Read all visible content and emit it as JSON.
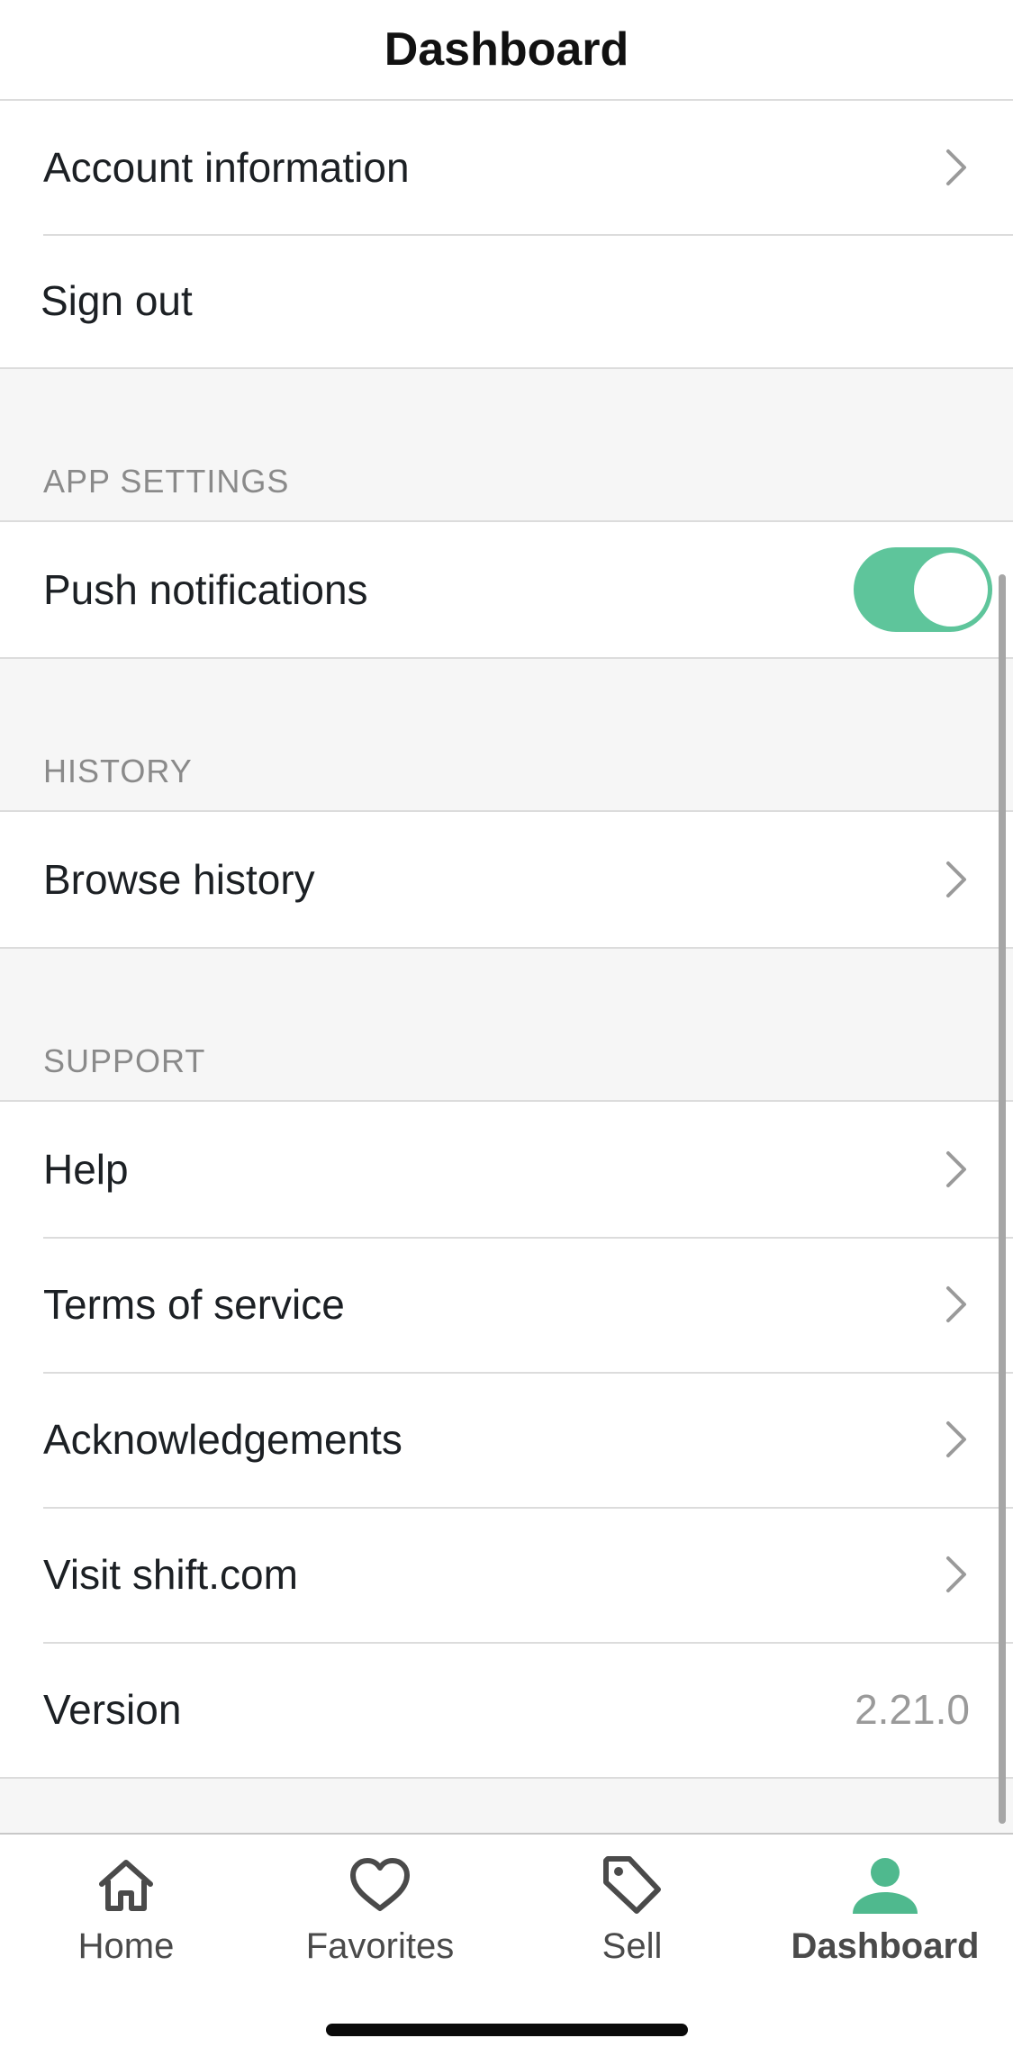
{
  "header": {
    "title": "Dashboard"
  },
  "account": {
    "items": [
      {
        "label": "Account information"
      },
      {
        "label": "Sign out"
      }
    ]
  },
  "app_settings": {
    "header": "APP SETTINGS",
    "push_notifications": {
      "label": "Push notifications",
      "enabled": true
    }
  },
  "history": {
    "header": "HISTORY",
    "items": [
      {
        "label": "Browse history"
      }
    ]
  },
  "support": {
    "header": "SUPPORT",
    "items": [
      {
        "label": "Help"
      },
      {
        "label": "Terms of service"
      },
      {
        "label": "Acknowledgements"
      },
      {
        "label": "Visit shift.com"
      }
    ],
    "version": {
      "label": "Version",
      "value": "2.21.0"
    }
  },
  "tabbar": {
    "tabs": [
      {
        "label": "Home",
        "icon": "home-icon"
      },
      {
        "label": "Favorites",
        "icon": "heart-icon"
      },
      {
        "label": "Sell",
        "icon": "tag-icon"
      },
      {
        "label": "Dashboard",
        "icon": "person-icon",
        "active": true
      }
    ]
  },
  "colors": {
    "accent": "#5ec59b",
    "active_tab_icon": "#4fb98e",
    "text": "#1c2024",
    "section_header": "#8a8a8a",
    "background": "#f6f6f6"
  }
}
